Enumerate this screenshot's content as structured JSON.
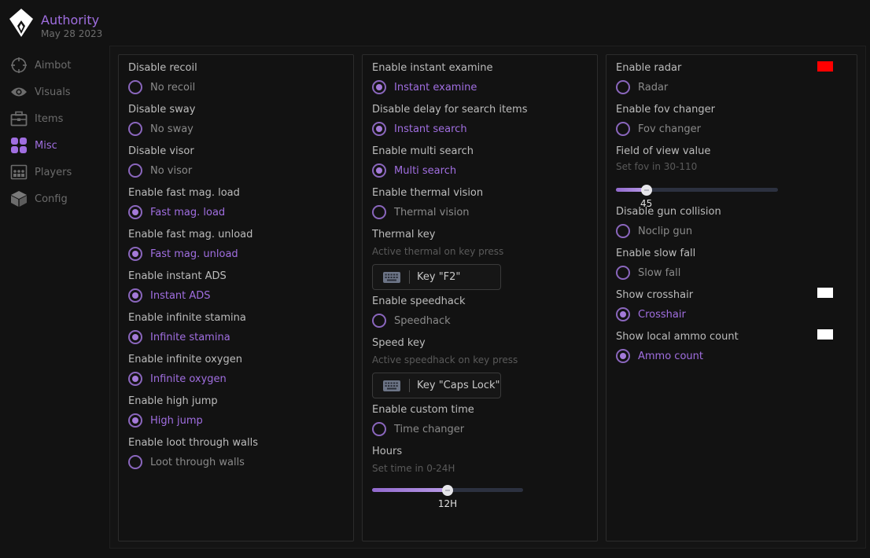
{
  "brand": {
    "name": "Authority",
    "date": "May 28 2023"
  },
  "sidebar": {
    "items": [
      {
        "label": "Aimbot",
        "icon": "crosshair-icon"
      },
      {
        "label": "Visuals",
        "icon": "eye-icon"
      },
      {
        "label": "Items",
        "icon": "briefcase-icon"
      },
      {
        "label": "Misc",
        "icon": "grid-icon"
      },
      {
        "label": "Players",
        "icon": "players-icon"
      },
      {
        "label": "Config",
        "icon": "cube-icon"
      }
    ],
    "active": "Misc"
  },
  "colors": {
    "accent": "#a06ee0",
    "radar_color": "#ff0000",
    "crosshair_color": "#ffffff",
    "ammo_color": "#ffffff"
  },
  "panel1": {
    "recoil": {
      "title": "Disable recoil",
      "label": "No recoil",
      "checked": false
    },
    "sway": {
      "title": "Disable sway",
      "label": "No sway",
      "checked": false
    },
    "visor": {
      "title": "Disable visor",
      "label": "No visor",
      "checked": false
    },
    "fast_load": {
      "title": "Enable fast mag. load",
      "label": "Fast mag. load",
      "checked": true
    },
    "fast_unload": {
      "title": "Enable fast mag. unload",
      "label": "Fast mag. unload",
      "checked": true
    },
    "ads": {
      "title": "Enable instant ADS",
      "label": "Instant ADS",
      "checked": true
    },
    "stamina": {
      "title": "Enable infinite stamina",
      "label": "Infinite stamina",
      "checked": true
    },
    "oxygen": {
      "title": "Enable infinite oxygen",
      "label": "Infinite oxygen",
      "checked": true
    },
    "jump": {
      "title": "Enable high jump",
      "label": "High jump",
      "checked": true
    },
    "loot": {
      "title": "Enable loot through walls",
      "label": "Loot through walls",
      "checked": false
    }
  },
  "panel2": {
    "examine": {
      "title": "Enable instant examine",
      "label": "Instant examine",
      "checked": true
    },
    "search": {
      "title": "Disable delay for search items",
      "label": "Instant search",
      "checked": true
    },
    "multi": {
      "title": "Enable multi search",
      "label": "Multi search",
      "checked": true
    },
    "thermal": {
      "title": "Enable thermal vision",
      "label": "Thermal vision",
      "checked": false
    },
    "thermal_key": {
      "title": "Thermal key",
      "desc": "Active thermal on key press",
      "key": "Key \"F2\""
    },
    "speed": {
      "title": "Enable speedhack",
      "label": "Speedhack",
      "checked": false
    },
    "speed_key": {
      "title": "Speed key",
      "desc": "Active speedhack on key press",
      "key": "Key \"Caps Lock\""
    },
    "time": {
      "title": "Enable custom time",
      "label": "Time changer",
      "checked": false
    },
    "hours": {
      "title": "Hours",
      "desc": "Set time in 0-24H",
      "value": 12,
      "min": 0,
      "max": 24,
      "display": "12H"
    }
  },
  "panel3": {
    "radar": {
      "title": "Enable radar",
      "label": "Radar",
      "checked": false
    },
    "fov": {
      "title": "Enable fov changer",
      "label": "Fov changer",
      "checked": false
    },
    "fov_value": {
      "title": "Field of view value",
      "desc": "Set fov in 30-110",
      "value": 45,
      "min": 30,
      "max": 110,
      "display": "45"
    },
    "gun": {
      "title": "Disable gun collision",
      "label": "Noclip gun",
      "checked": false
    },
    "fall": {
      "title": "Enable slow fall",
      "label": "Slow fall",
      "checked": false
    },
    "crosshair": {
      "title": "Show crosshair",
      "label": "Crosshair",
      "checked": true
    },
    "ammo": {
      "title": "Show local ammo count",
      "label": "Ammo count",
      "checked": true
    }
  }
}
